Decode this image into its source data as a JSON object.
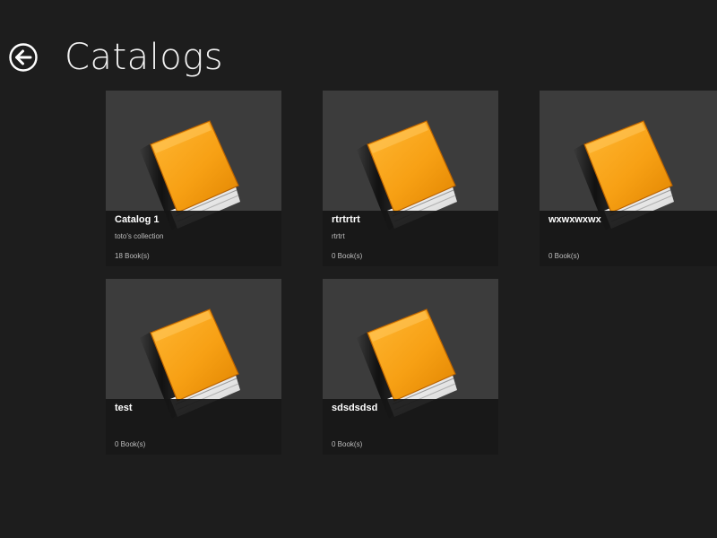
{
  "header": {
    "title": "Catalogs"
  },
  "catalogs": [
    {
      "name": "Catalog 1",
      "description": "toto's collection",
      "count": "18 Book(s)"
    },
    {
      "name": "rtrtrtrt",
      "description": "rtrtrt",
      "count": "0 Book(s)"
    },
    {
      "name": "wxwxwxwx",
      "description": "",
      "count": "0 Book(s)"
    },
    {
      "name": "test",
      "description": "",
      "count": "0 Book(s)"
    },
    {
      "name": "sdsdsdsd",
      "description": "",
      "count": "0 Book(s)"
    }
  ],
  "colors": {
    "background": "#1d1d1d",
    "tile_background": "#3c3c3c",
    "tile_info_background": "#161616",
    "book_orange": "#f59a12"
  },
  "icons": {
    "back": "back-arrow-circle-icon",
    "catalog": "book-icon"
  }
}
